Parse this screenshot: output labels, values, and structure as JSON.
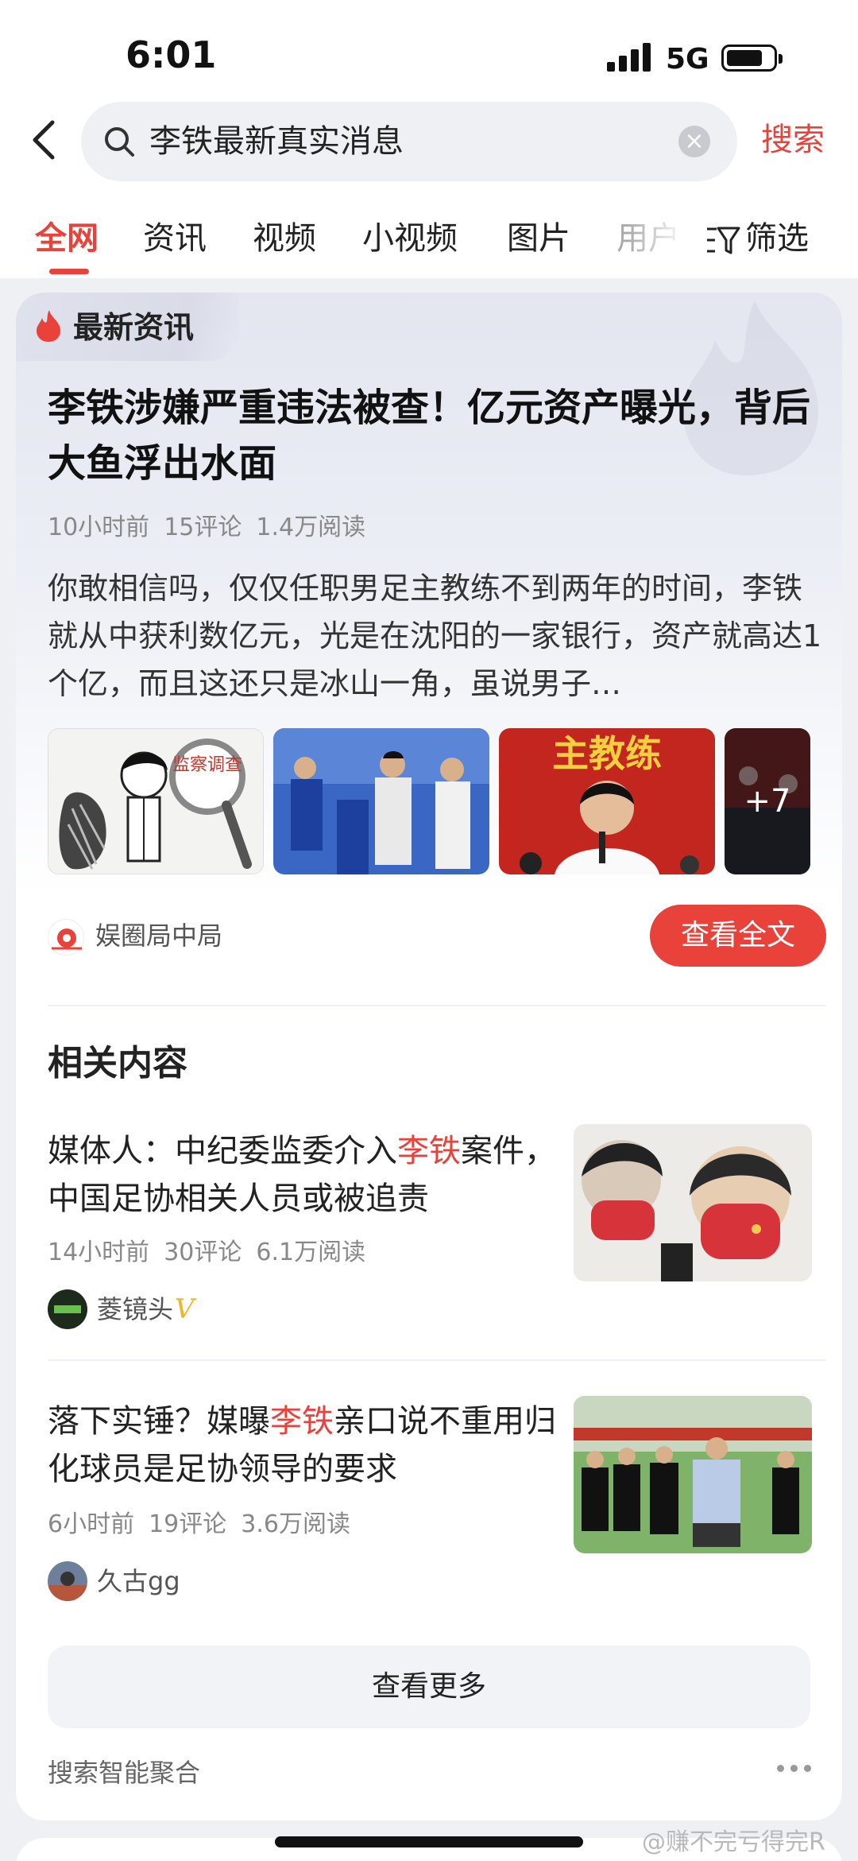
{
  "status_bar": {
    "time": "6:01",
    "network": "5G"
  },
  "search": {
    "query": "李铁最新真实消息",
    "submit_label": "搜索"
  },
  "tabs": [
    {
      "label": "全网",
      "active": true
    },
    {
      "label": "资讯"
    },
    {
      "label": "视频"
    },
    {
      "label": "小视频"
    },
    {
      "label": "图片"
    },
    {
      "label": "用户"
    }
  ],
  "filter_label": "筛选",
  "featured": {
    "badge": "最新资讯",
    "headline": "李铁涉嫌严重违法被查！亿元资产曝光，背后大鱼浮出水面",
    "meta": {
      "time": "10小时前",
      "comments": "15评论",
      "reads": "1.4万阅读"
    },
    "summary": "你敢相信吗，仅仅任职男足主教练不到两年的时间，李铁就从中获利数亿元，光是在沈阳的一家银行，资产就高达1个亿，而且这还只是冰山一角，虽说男子…",
    "images": [
      {
        "caption": "监察调查"
      },
      {
        "caption": ""
      },
      {
        "caption": "主教练"
      },
      {
        "caption": ""
      }
    ],
    "more_images": "+7",
    "source": "娱圈局中局",
    "read_full": "查看全文"
  },
  "related": {
    "title": "相关内容",
    "items": [
      {
        "title_before": "媒体人：中纪委监委介入",
        "title_highlight": "李铁",
        "title_after": "案件，中国足协相关人员或被追责",
        "time": "14小时前",
        "comments": "30评论",
        "reads": "6.1万阅读",
        "author": "菱镜头",
        "verified": "V"
      },
      {
        "title_before": "落下实锤？媒曝",
        "title_highlight": "李铁",
        "title_after": "亲口说不重用归化球员是足协领导的要求",
        "time": "6小时前",
        "comments": "19评论",
        "reads": "3.6万阅读",
        "author": "久古gg"
      }
    ],
    "see_more": "查看更多",
    "aggregation": "搜索智能聚合"
  },
  "watermark": "@赚不完亏得完R",
  "colors": {
    "accent": "#e8423b",
    "text": "#222222",
    "meta": "#888888"
  }
}
